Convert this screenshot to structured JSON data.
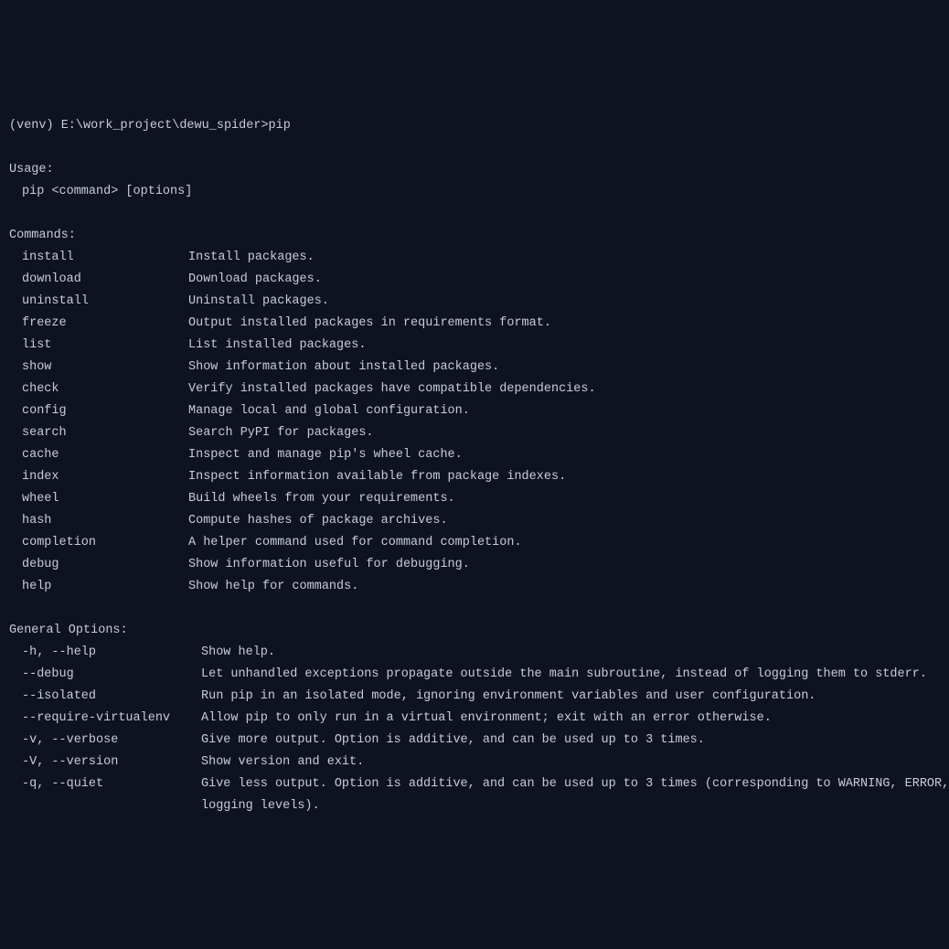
{
  "prompt": "(venv) E:\\work_project\\dewu_spider>pip",
  "blank": "",
  "usage_header": "Usage:",
  "usage_line": "pip <command> [options]",
  "commands_header": "Commands:",
  "commands": [
    {
      "name": "install",
      "desc": "Install packages."
    },
    {
      "name": "download",
      "desc": "Download packages."
    },
    {
      "name": "uninstall",
      "desc": "Uninstall packages."
    },
    {
      "name": "freeze",
      "desc": "Output installed packages in requirements format."
    },
    {
      "name": "list",
      "desc": "List installed packages."
    },
    {
      "name": "show",
      "desc": "Show information about installed packages."
    },
    {
      "name": "check",
      "desc": "Verify installed packages have compatible dependencies."
    },
    {
      "name": "config",
      "desc": "Manage local and global configuration."
    },
    {
      "name": "search",
      "desc": "Search PyPI for packages."
    },
    {
      "name": "cache",
      "desc": "Inspect and manage pip's wheel cache."
    },
    {
      "name": "index",
      "desc": "Inspect information available from package indexes."
    },
    {
      "name": "wheel",
      "desc": "Build wheels from your requirements."
    },
    {
      "name": "hash",
      "desc": "Compute hashes of package archives."
    },
    {
      "name": "completion",
      "desc": "A helper command used for command completion."
    },
    {
      "name": "debug",
      "desc": "Show information useful for debugging."
    },
    {
      "name": "help",
      "desc": "Show help for commands."
    }
  ],
  "options_header": "General Options:",
  "options": [
    {
      "flag": "-h, --help",
      "desc": "Show help."
    },
    {
      "flag": "--debug",
      "desc": "Let unhandled exceptions propagate outside the main subroutine, instead of logging them to stderr."
    },
    {
      "flag": "--isolated",
      "desc": "Run pip in an isolated mode, ignoring environment variables and user configuration."
    },
    {
      "flag": "--require-virtualenv",
      "desc": "Allow pip to only run in a virtual environment; exit with an error otherwise."
    },
    {
      "flag": "-v, --verbose",
      "desc": "Give more output. Option is additive, and can be used up to 3 times."
    },
    {
      "flag": "-V, --version",
      "desc": "Show version and exit."
    },
    {
      "flag": "-q, --quiet",
      "desc": "Give less output. Option is additive, and can be used up to 3 times (corresponding to WARNING, ERROR, and CRITICAL",
      "cont": "logging levels)."
    }
  ]
}
